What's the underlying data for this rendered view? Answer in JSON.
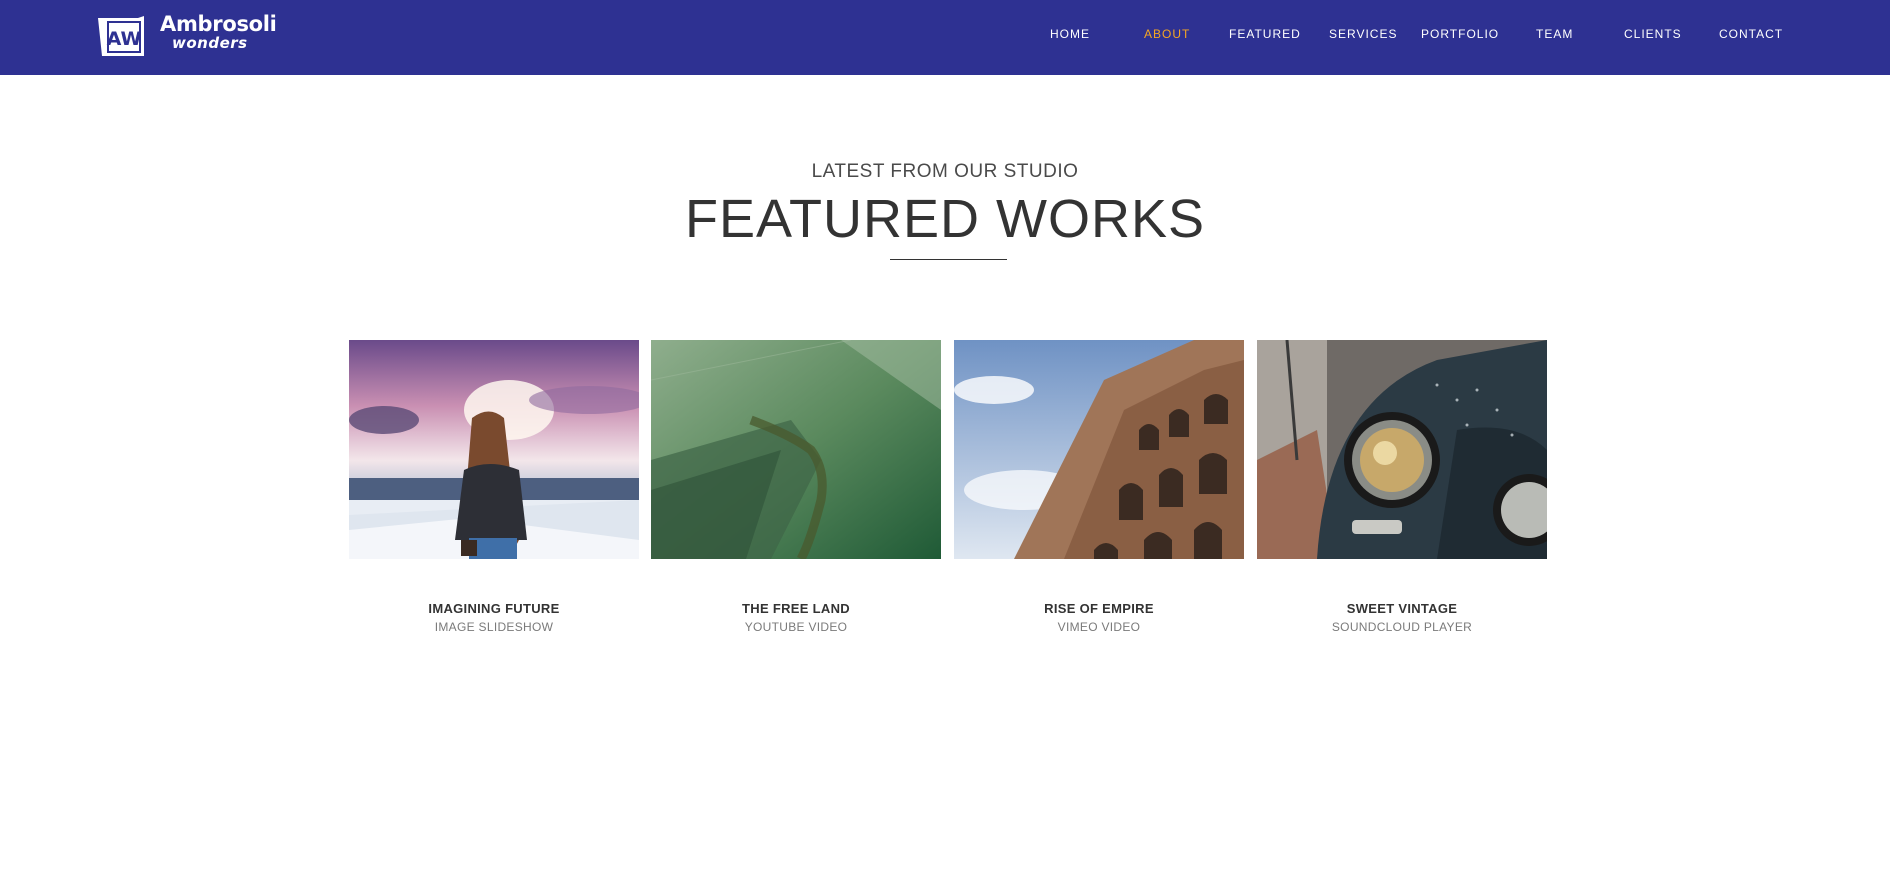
{
  "brand": {
    "logo_mark": "AW",
    "name": "Ambrosoli",
    "tagline": "wonders"
  },
  "nav": {
    "items": [
      {
        "label": "HOME"
      },
      {
        "label": "ABOUT",
        "active": true
      },
      {
        "label": "FEATURED"
      },
      {
        "label": "SERVICES"
      },
      {
        "label": "PORTFOLIO"
      },
      {
        "label": "TEAM"
      },
      {
        "label": "CLIENTS"
      },
      {
        "label": "CONTACT"
      }
    ]
  },
  "featured": {
    "eyebrow": "LATEST FROM OUR STUDIO",
    "title": "FEATURED WORKS",
    "works": [
      {
        "title": "IMAGINING FUTURE",
        "subtitle": "IMAGE SLIDESHOW"
      },
      {
        "title": "THE FREE LAND",
        "subtitle": "YOUTUBE VIDEO"
      },
      {
        "title": "RISE OF EMPIRE",
        "subtitle": "VIMEO VIDEO"
      },
      {
        "title": "SWEET VINTAGE",
        "subtitle": "SOUNDCLOUD PLAYER"
      }
    ]
  },
  "colors": {
    "header_bg": "#2e3192",
    "nav_active": "#f5a623",
    "text_dark": "#333333",
    "text_muted": "#7a7a7a"
  }
}
